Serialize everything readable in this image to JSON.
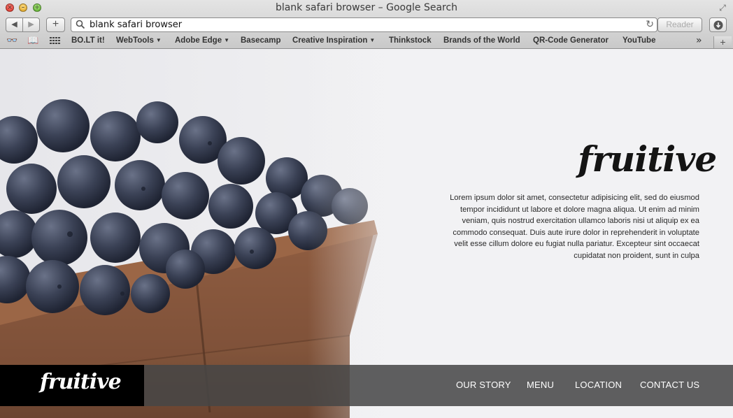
{
  "window": {
    "title": "blank safari browser – Google Search"
  },
  "toolbar": {
    "back_label": "◀",
    "forward_label": "▶",
    "new_tab_label": "+",
    "address_value": "blank safari browser",
    "reload_label": "↻",
    "reader_label": "Reader",
    "download_label": "⬇"
  },
  "bookmarks_bar": {
    "items": [
      {
        "label": "BO.LT it!"
      },
      {
        "label": "WebTools"
      },
      {
        "label": "Adobe Edge"
      },
      {
        "label": "Basecamp"
      },
      {
        "label": "Creative Inspiration"
      },
      {
        "label": "Thinkstock"
      },
      {
        "label": "Brands of the World"
      },
      {
        "label": "QR-Code Generator"
      },
      {
        "label": "YouTube"
      }
    ],
    "more_label": "»",
    "add_label": "+"
  },
  "page": {
    "brand": "fruitive",
    "intro_text": "Lorem ipsum dolor sit amet, consectetur adipisicing elit, sed do eiusmod tempor incididunt ut labore et dolore magna aliqua. Ut enim ad minim veniam, quis nostrud exercitation ullamco laboris nisi ut aliquip ex ea commodo consequat. Duis aute irure dolor in reprehenderit in voluptate velit esse cillum dolore eu fugiat nulla pariatur. Excepteur sint occaecat cupidatat non proident, sunt in culpa",
    "footer": {
      "logo": "fruitive",
      "nav": [
        {
          "label": "OUR STORY"
        },
        {
          "label": "MENU"
        },
        {
          "label": "LOCATION"
        },
        {
          "label": "CONTACT US"
        }
      ]
    }
  },
  "colors": {
    "page_background": "#f2f2f4",
    "footer_bar": "#464646",
    "footer_logo_box": "#000000",
    "basket": "#8b5a3c",
    "blueberry": "#3b4256"
  }
}
